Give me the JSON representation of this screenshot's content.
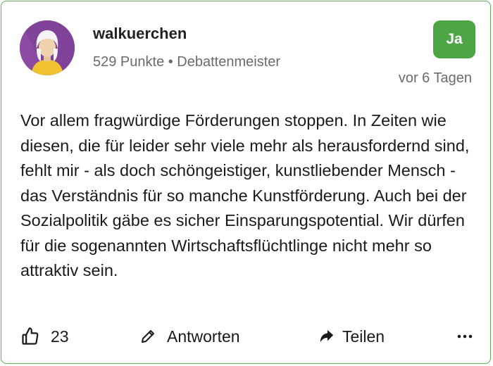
{
  "post": {
    "username": "walkuerchen",
    "meta": "529 Punkte • Debattenmeister",
    "vote_badge": "Ja",
    "timestamp": "vor 6 Tagen",
    "body": "Vor allem fragwürdige Förderungen stoppen. In Zeiten wie diesen, die für leider sehr viele mehr als herausfordernd sind, fehlt mir - als doch schöngeistiger, kunstliebender Mensch - das Verständnis für so manche Kunstförderung. Auch bei der Sozialpolitik gäbe es sicher Einsparungspotential. Wir dürfen für die sogenannten Wirtschaftsflüchtlinge nicht mehr so attraktiv sein.",
    "accent_color": "#4ea546"
  },
  "actions": {
    "like_count": "23",
    "reply_label": "Antworten",
    "share_label": "Teilen",
    "icons": [
      "thumbs-up-icon",
      "pencil-icon",
      "share-arrow-icon",
      "more-dots-icon"
    ]
  }
}
